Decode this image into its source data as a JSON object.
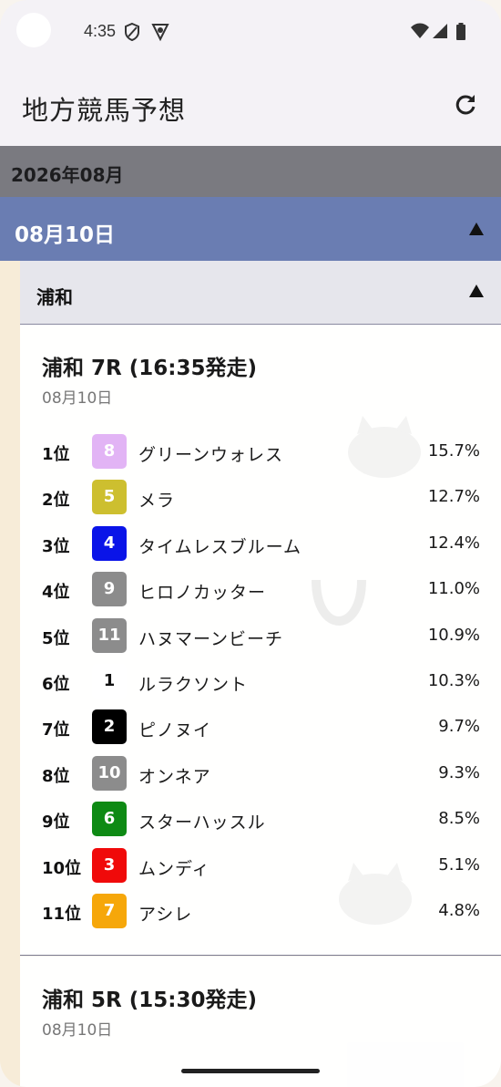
{
  "status": {
    "time": "4:35"
  },
  "app": {
    "title": "地方競馬予想",
    "refresh_icon": "refresh-icon"
  },
  "month": {
    "label": "2026年08月"
  },
  "date": {
    "label": "08月10日"
  },
  "venue": {
    "label": "浦和"
  },
  "races": [
    {
      "title": "浦和 7R (16:35発走)",
      "date": "08月10日",
      "entries": [
        {
          "rank": "1位",
          "number": "8",
          "color": "#e2b4f5",
          "text_color": "#ffffff",
          "name": "グリーンウォレス",
          "pct": "15.7%"
        },
        {
          "rank": "2位",
          "number": "5",
          "color": "#cdbf2f",
          "text_color": "#ffffff",
          "name": "メラ",
          "pct": "12.7%"
        },
        {
          "rank": "3位",
          "number": "4",
          "color": "#0a14e8",
          "text_color": "#ffffff",
          "name": "タイムレスブルーム",
          "pct": "12.4%"
        },
        {
          "rank": "4位",
          "number": "9",
          "color": "#8c8c8c",
          "text_color": "#ffffff",
          "name": "ヒロノカッター",
          "pct": "11.0%"
        },
        {
          "rank": "5位",
          "number": "11",
          "color": "#8c8c8c",
          "text_color": "#ffffff",
          "name": "ハヌマーンビーチ",
          "pct": "10.9%"
        },
        {
          "rank": "6位",
          "number": "1",
          "color": "#ffffff",
          "text_color": "#111111",
          "name": "ルラクソント",
          "pct": "10.3%"
        },
        {
          "rank": "7位",
          "number": "2",
          "color": "#000000",
          "text_color": "#ffffff",
          "name": "ピノヌイ",
          "pct": "9.7%"
        },
        {
          "rank": "8位",
          "number": "10",
          "color": "#8c8c8c",
          "text_color": "#ffffff",
          "name": "オンネア",
          "pct": "9.3%"
        },
        {
          "rank": "9位",
          "number": "6",
          "color": "#0e8a14",
          "text_color": "#ffffff",
          "name": "スターハッスル",
          "pct": "8.5%"
        },
        {
          "rank": "10位",
          "number": "3",
          "color": "#f00a0a",
          "text_color": "#ffffff",
          "name": "ムンディ",
          "pct": "5.1%"
        },
        {
          "rank": "11位",
          "number": "7",
          "color": "#f6a70a",
          "text_color": "#ffffff",
          "name": "アシレ",
          "pct": "4.8%"
        }
      ]
    },
    {
      "title": "浦和 5R (15:30発走)",
      "date": "08月10日"
    }
  ]
}
